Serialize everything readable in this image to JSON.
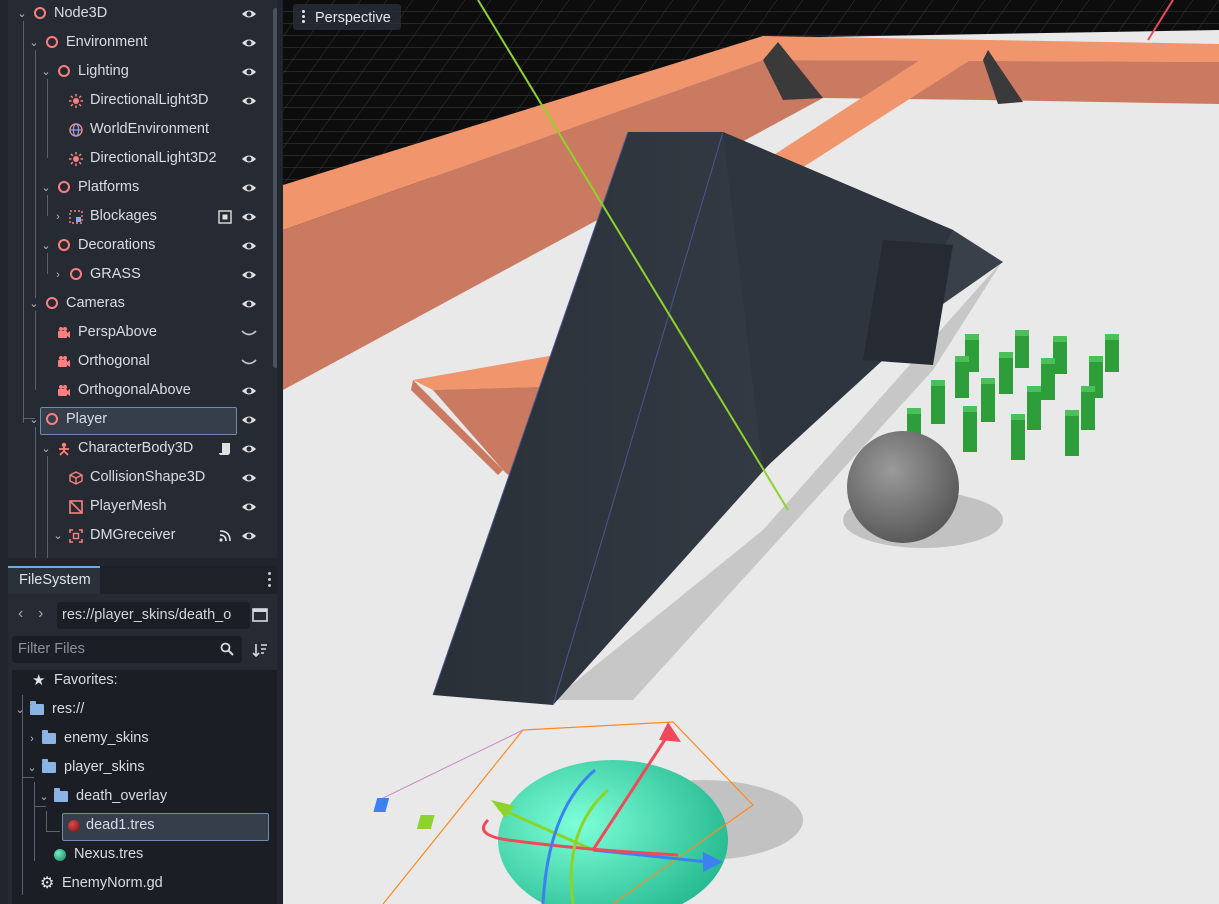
{
  "scene_tree": {
    "nodes": [
      {
        "label": "Node3D",
        "icon": "node3d-icon"
      },
      {
        "label": "Environment",
        "icon": "node3d-icon"
      },
      {
        "label": "Lighting",
        "icon": "node3d-icon"
      },
      {
        "label": "DirectionalLight3D",
        "icon": "light-icon"
      },
      {
        "label": "WorldEnvironment",
        "icon": "globe-icon"
      },
      {
        "label": "DirectionalLight3D2",
        "icon": "light-icon"
      },
      {
        "label": "Platforms",
        "icon": "node3d-icon"
      },
      {
        "label": "Blockages",
        "icon": "gridmap-icon"
      },
      {
        "label": "Decorations",
        "icon": "node3d-icon"
      },
      {
        "label": "GRASS",
        "icon": "node3d-icon"
      },
      {
        "label": "Cameras",
        "icon": "node3d-icon"
      },
      {
        "label": "PerspAbove",
        "icon": "camera-icon"
      },
      {
        "label": "Orthogonal",
        "icon": "camera-icon"
      },
      {
        "label": "OrthogonalAbove",
        "icon": "camera-icon"
      },
      {
        "label": "Player",
        "icon": "node3d-icon"
      },
      {
        "label": "CharacterBody3D",
        "icon": "character-icon"
      },
      {
        "label": "CollisionShape3D",
        "icon": "collision-icon"
      },
      {
        "label": "PlayerMesh",
        "icon": "mesh-icon"
      },
      {
        "label": "DMGreceiver",
        "icon": "area-icon"
      }
    ]
  },
  "filesystem": {
    "tab_label": "FileSystem",
    "path": "res://player_skins/death_o",
    "filter_placeholder": "Filter Files",
    "items": [
      {
        "label": "Favorites:"
      },
      {
        "label": "res://"
      },
      {
        "label": "enemy_skins"
      },
      {
        "label": "player_skins"
      },
      {
        "label": "death_overlay"
      },
      {
        "label": "dead1.tres"
      },
      {
        "label": "Nexus.tres"
      },
      {
        "label": "EnemyNorm.gd"
      }
    ]
  },
  "viewport": {
    "mode_label": "Perspective"
  },
  "colors": {
    "node_red": "#fc7f7f",
    "folder_blue": "#8bb4e4",
    "accent": "#70a7e8"
  }
}
